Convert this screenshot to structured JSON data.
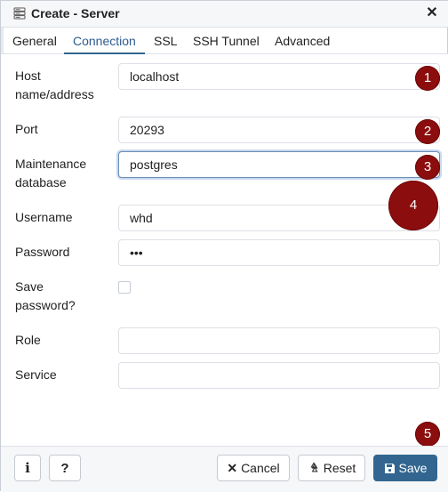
{
  "dialog": {
    "title": "Create - Server"
  },
  "tabs": [
    {
      "label": "General",
      "active": false
    },
    {
      "label": "Connection",
      "active": true
    },
    {
      "label": "SSL",
      "active": false
    },
    {
      "label": "SSH Tunnel",
      "active": false
    },
    {
      "label": "Advanced",
      "active": false
    }
  ],
  "fields": {
    "host": {
      "label_line1": "Host",
      "label_line2": "name/address",
      "value": "localhost"
    },
    "port": {
      "label": "Port",
      "value": "20293"
    },
    "maintenance_db": {
      "label_line1": "Maintenance",
      "label_line2": "database",
      "value": "postgres"
    },
    "username": {
      "label": "Username",
      "value": "whd"
    },
    "password": {
      "label": "Password",
      "value": "•••"
    },
    "save_password": {
      "label_line1": "Save",
      "label_line2": "password?",
      "checked": false
    },
    "role": {
      "label": "Role",
      "value": ""
    },
    "service": {
      "label": "Service",
      "value": ""
    }
  },
  "markers": [
    "1",
    "2",
    "3",
    "4",
    "5"
  ],
  "footer": {
    "info_label": "i",
    "help_label": "?",
    "cancel_label": "Cancel",
    "reset_label": "Reset",
    "save_label": "Save"
  },
  "colors": {
    "accent": "#326690",
    "marker": "#8b0d0d",
    "tab_active": "#2c5b8f"
  }
}
